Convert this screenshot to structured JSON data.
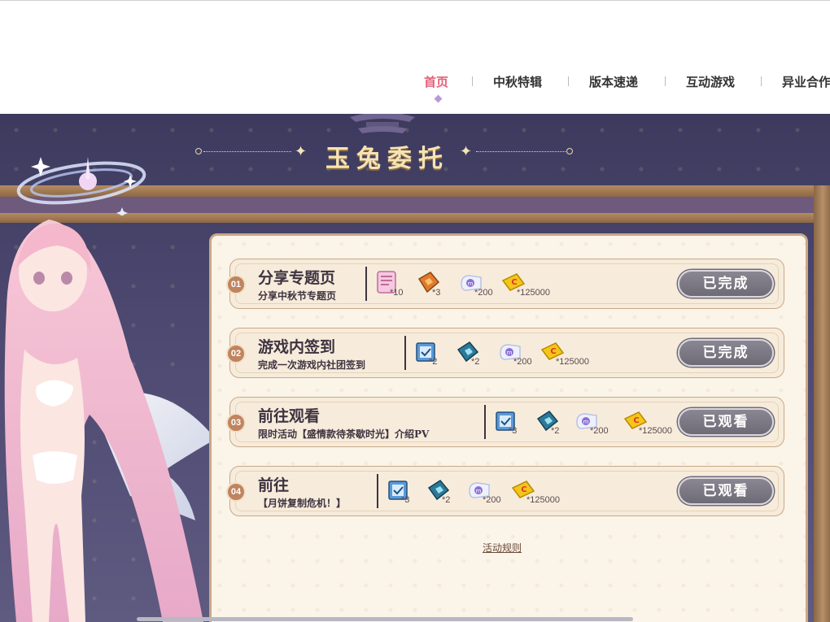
{
  "nav": {
    "items": [
      {
        "label": "首页",
        "active": true
      },
      {
        "label": "中秋特辑",
        "active": false
      },
      {
        "label": "版本速递",
        "active": false
      },
      {
        "label": "互动游戏",
        "active": false
      },
      {
        "label": "异业合作",
        "active": false
      }
    ],
    "active_color": "#e5607a"
  },
  "banner": {
    "title": "玉兔委托"
  },
  "tasks": [
    {
      "num": "01",
      "title": "分享专题页",
      "desc": "分享中秋节专题页",
      "rewards": [
        {
          "icon": "notebook-icon",
          "qty": "*10"
        },
        {
          "icon": "orange-ticket-icon",
          "qty": "*3"
        },
        {
          "icon": "currency-card-icon",
          "qty": "*200"
        },
        {
          "icon": "gold-coin-icon",
          "qty": "*125000"
        }
      ],
      "status": "已完成"
    },
    {
      "num": "02",
      "title": "游戏内签到",
      "desc": "完成一次游戏内社团签到",
      "rewards": [
        {
          "icon": "blue-box-icon",
          "qty": "*2"
        },
        {
          "icon": "teal-ticket-icon",
          "qty": "*2"
        },
        {
          "icon": "currency-card-icon",
          "qty": "*200"
        },
        {
          "icon": "gold-coin-icon",
          "qty": "*125000"
        }
      ],
      "status": "已完成"
    },
    {
      "num": "03",
      "title": "前往观看",
      "desc": "限时活动【盛情款待茶歇时光】介绍PV",
      "rewards": [
        {
          "icon": "blue-box-icon",
          "qty": "*3"
        },
        {
          "icon": "teal-ticket-icon",
          "qty": "*2"
        },
        {
          "icon": "currency-card-icon",
          "qty": "*200"
        },
        {
          "icon": "gold-coin-icon",
          "qty": "*125000"
        }
      ],
      "status": "已观看"
    },
    {
      "num": "04",
      "title": "前往",
      "desc": "【月饼复制危机！】",
      "rewards": [
        {
          "icon": "blue-box-icon",
          "qty": "*3"
        },
        {
          "icon": "teal-ticket-icon",
          "qty": "*2"
        },
        {
          "icon": "currency-card-icon",
          "qty": "*200"
        },
        {
          "icon": "gold-coin-icon",
          "qty": "*125000"
        }
      ],
      "status": "已观看"
    }
  ],
  "rules_link": "活动规则"
}
